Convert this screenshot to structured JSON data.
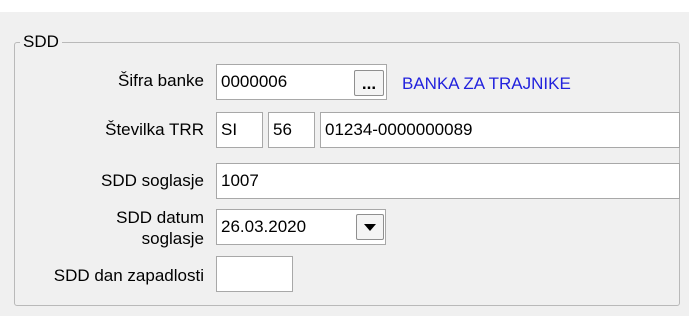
{
  "group": {
    "title": "SDD"
  },
  "bank_code": {
    "label": "Šifra banke",
    "value": "0000006",
    "browse_button": "...",
    "bank_name": "BANKA ZA TRAJNIKE"
  },
  "account": {
    "label": "Številka TRR",
    "country": "SI",
    "check_digits": "56",
    "number": "01234-0000000089"
  },
  "consent": {
    "label": "SDD soglasje",
    "value": "1007"
  },
  "consent_date": {
    "label_line1": "SDD datum",
    "label_line2": "soglasje",
    "value": "26.03.2020",
    "icon": "chevron-down-icon"
  },
  "due_day": {
    "label": "SDD dan zapadlosti",
    "value": ""
  }
}
